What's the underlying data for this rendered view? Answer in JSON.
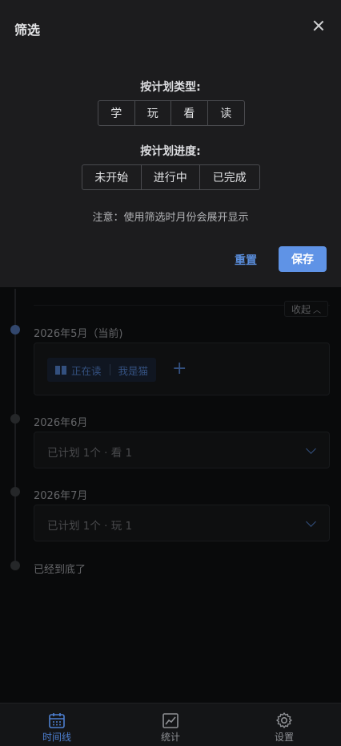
{
  "filter_panel": {
    "title": "筛选",
    "type_label": "按计划类型:",
    "type_options": [
      "学",
      "玩",
      "看",
      "读"
    ],
    "progress_label": "按计划进度:",
    "progress_options": [
      "未开始",
      "进行中",
      "已完成"
    ],
    "note": "注意：使用筛选时月份会展开显示",
    "reset_label": "重置",
    "save_label": "保存"
  },
  "timeline": {
    "collapse_label": "收起",
    "months": [
      {
        "label": "2026年5月（当前)",
        "current": true,
        "tag_status": "正在读",
        "tag_title": "我是猫"
      },
      {
        "label": "2026年6月",
        "summary": "已计划 1个 · 看 1"
      },
      {
        "label": "2026年7月",
        "summary": "已计划 1个 · 玩 1"
      }
    ],
    "end_label": "已经到底了"
  },
  "bottom_nav": {
    "items": [
      {
        "label": "时间线",
        "icon": "calendar-icon",
        "active": true
      },
      {
        "label": "统计",
        "icon": "chart-icon",
        "active": false
      },
      {
        "label": "设置",
        "icon": "gear-icon",
        "active": false
      }
    ]
  },
  "colors": {
    "accent": "#5f93e6",
    "link": "#4f7cc4",
    "panel_bg": "#1c1c1e",
    "page_bg": "#0f1012"
  }
}
